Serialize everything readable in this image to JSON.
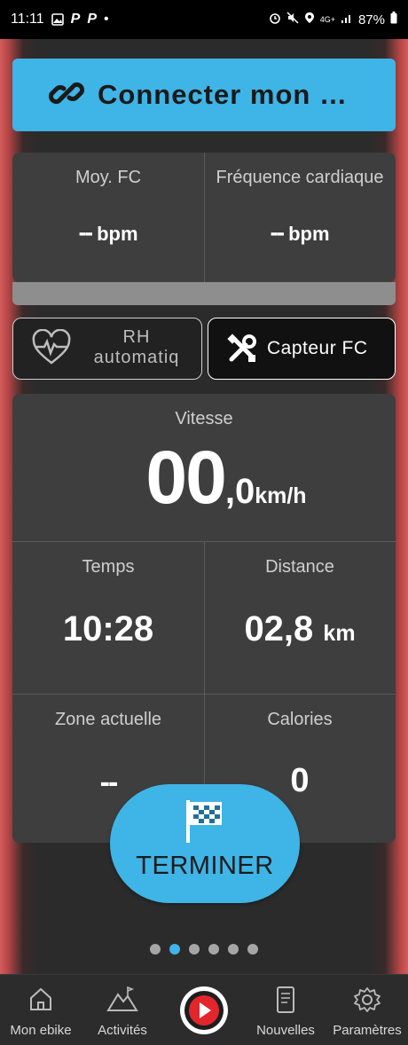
{
  "status_bar": {
    "time": "11:11",
    "notif_letters": [
      "P",
      "P"
    ],
    "dot": "•",
    "battery": "87%",
    "network": "4G+"
  },
  "connect": {
    "label": "Connecter mon …",
    "icon": "link-icon"
  },
  "heart_rate": {
    "avg_label": "Moy. FC",
    "avg_value": "--",
    "avg_unit": "bpm",
    "current_label": "Fréquence cardiaque",
    "current_value": "--",
    "current_unit": "bpm"
  },
  "buttons": {
    "rh_label_line1": "RH",
    "rh_label_line2": "automatiq",
    "sensor_label": "Capteur FC"
  },
  "stats": {
    "speed_label": "Vitesse",
    "speed_int": "00",
    "speed_dec": ",0",
    "speed_unit": "km/h",
    "time_label": "Temps",
    "time_value": "10:28",
    "distance_label": "Distance",
    "distance_value": "02,8",
    "distance_unit": "km",
    "zone_label": "Zone actuelle",
    "zone_value": "--",
    "calories_label": "Calories",
    "calories_value": "0"
  },
  "finish": {
    "label": "TERMINER",
    "icon": "checkered-flag-icon"
  },
  "pager": {
    "count": 6,
    "active_index": 1
  },
  "nav": {
    "home": "Mon ebike",
    "activities": "Activités",
    "news": "Nouvelles",
    "settings": "Paramètres"
  },
  "colors": {
    "accent": "#3fb4e6",
    "panel": "#3e3e3e",
    "record": "#e3262c"
  }
}
